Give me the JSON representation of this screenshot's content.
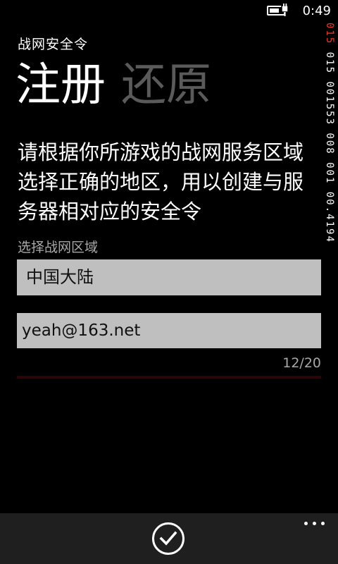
{
  "status_bar": {
    "time": "0:49",
    "battery_level": 0.7,
    "battery_icon": "battery-icon",
    "charging_icon": "charging-plug-icon"
  },
  "app": {
    "title": "战网安全令"
  },
  "pivot": {
    "tabs": [
      {
        "label": "注册",
        "active": true
      },
      {
        "label": "还原",
        "active": false
      }
    ]
  },
  "main": {
    "description": "请根据你所游戏的战网服务区域选择正确的地区，用以创建与服务器相对应的安全令",
    "region_label": "选择战网区域",
    "region_value": "中国大陆",
    "email_value": "yeah@163.net",
    "email_counter": "12/20"
  },
  "debug_counter": {
    "prefix": "015",
    "body": " 015 001553 008 001 00.4194"
  },
  "app_bar": {
    "confirm_icon": "check-icon",
    "more_icon": "ellipsis-icon"
  },
  "colors": {
    "background": "#000000",
    "field_background": "#bfbfbf",
    "inactive_tab": "#5a5a5a",
    "label_gray": "#a8a8a8",
    "accent_red": "#e53a28",
    "app_bar": "#1f1f1f"
  }
}
